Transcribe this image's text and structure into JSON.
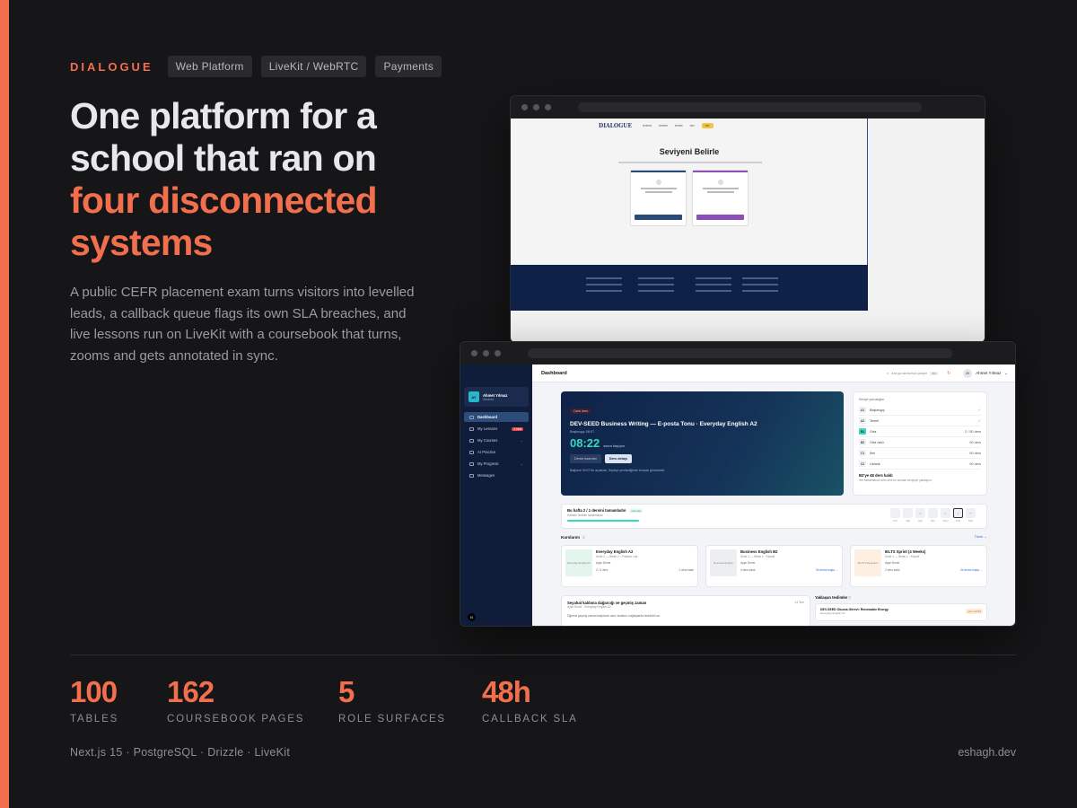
{
  "brand": "DIALOGUE",
  "tags": [
    "Web Platform",
    "LiveKit / WebRTC",
    "Payments"
  ],
  "headline": {
    "line1": "One platform for a",
    "line2": "school that ran on",
    "line3": "four disconnected",
    "line4": "systems"
  },
  "lede": "A public CEFR placement exam turns visitors into levelled leads, a callback queue flags its own SLA breaches, and live lessons run on LiveKit with a coursebook that turns, zooms and gets annotated in sync.",
  "placement": {
    "logo": "DIALOGUE",
    "title": "Seviyeni Belirle"
  },
  "dashboard": {
    "title": "Dashboard",
    "search_placeholder": "Ara ya da komut çalıştır",
    "kbd": "⌘K",
    "user_name": "Ahmet Yılmaz",
    "user_initials": "AY",
    "user_role": "Student",
    "nav": [
      {
        "label": "Dashboard",
        "badge": ""
      },
      {
        "label": "My Lessons",
        "badge": "1 new"
      },
      {
        "label": "My Courses",
        "badge": ""
      },
      {
        "label": "AI Practice",
        "badge": ""
      },
      {
        "label": "My Progress",
        "badge": ""
      },
      {
        "label": "Messages",
        "badge": ""
      }
    ],
    "hero": {
      "pill": "Canlı ders",
      "title": "DEV-SEED Business Writing — E-posta Tonu · Everyday English A2",
      "start": "Başlangıç 08:07",
      "countdown": "08:22",
      "countdown_suffix": "sonra başlıyor",
      "btn_join": "Derse hazırlan",
      "btn_detail": "Ders detayı",
      "note": "Bağlantı 00:07'de açılacak. Sayfayı yenilediğinde burada görünecek."
    },
    "levels": {
      "heading": "Seviye yolculuğun",
      "rows": [
        {
          "code": "A1",
          "name": "Başlangıç",
          "right": "✓"
        },
        {
          "code": "A2",
          "name": "Temel",
          "right": "✓"
        },
        {
          "code": "B1",
          "name": "Orta",
          "right": "2 / 50 ders"
        },
        {
          "code": "B2",
          "name": "Orta üstü",
          "right": "50 ders"
        },
        {
          "code": "C1",
          "name": "İleri",
          "right": "50 ders"
        },
        {
          "code": "C2",
          "name": "Ustalık",
          "right": "50 ders"
        }
      ],
      "foot": "B2'ye 48 ders kaldı",
      "foot_sub": "Her tamamlanan ders seni bir sonraki seviyeye yaklaştırır."
    },
    "week": {
      "title": "Bu hafta 2 / 1 dersini tamamladın",
      "pill": "yolunda",
      "sub": "Haftalık hedefin tamamlandı",
      "progress": 1,
      "days": [
        {
          "label": "Pzt",
          "mark": ""
        },
        {
          "label": "Sal",
          "mark": ""
        },
        {
          "label": "Çar",
          "mark": "✓"
        },
        {
          "label": "Per",
          "mark": ""
        },
        {
          "label": "Cum",
          "mark": "✓"
        },
        {
          "label": "Cmt",
          "mark": "•"
        },
        {
          "label": "Paz",
          "mark": "+"
        }
      ]
    },
    "courses_heading": "Kurslarım",
    "courses_count": "3",
    "courses_all": "Tümü →",
    "courses": [
      {
        "thumb": "Everyday English A2",
        "title": "Everyday English A2",
        "sub": "Ünite 2 — Week 2 · Practice Lab",
        "teacher": "Ayşe Demir",
        "progress": "2 / 4 ders",
        "right": "2 ders kaldı",
        "thumb_color": "#e4f5ee"
      },
      {
        "thumb": "Business English",
        "title": "Business English B2",
        "sub": "Ünite 1 — Week 1 · Kickoff",
        "teacher": "Ayşe Demir",
        "progress": "4 ders kaldı",
        "right": "İlk derse başla →",
        "thumb_color": "#eceef2"
      },
      {
        "thumb": "IELTS Preparation",
        "title": "IELTS Sprint (4 Weeks)",
        "sub": "Ünite 1 — Week 1 · Kickoff",
        "teacher": "Ayşe Demir",
        "progress": "2 ders kaldı",
        "right": "İlk derse başla →",
        "thumb_color": "#fdf0e2"
      }
    ],
    "topic": {
      "title": "Seyahat kalıbına dağarcığı ve geçmiş zaman",
      "sub": "Ayşe Demir · Everyday English A2",
      "date": "14 Tem",
      "body": "Öğrenci geçmiş zaman kalıplarını akıcı kullandı, bağlaçlarda tereddüt var."
    },
    "upcoming_heading": "Yaklaşan teslimler",
    "upcoming_count": "2",
    "upcoming": {
      "title": "DEV-SEED Okuma Görevi: Renewable Energy",
      "sub": "Everyday English A2",
      "badge": "yarın 23:59"
    }
  },
  "stats": [
    {
      "num": "100",
      "label": "TABLES"
    },
    {
      "num": "162",
      "label": "COURSEBOOK PAGES"
    },
    {
      "num": "5",
      "label": "ROLE SURFACES"
    },
    {
      "num": "48h",
      "label": "CALLBACK SLA"
    }
  ],
  "stack": "Next.js 15 · PostgreSQL · Drizzle · LiveKit",
  "site": "eshagh.dev",
  "colors": {
    "accent": "#f26f4e",
    "background": "#161618",
    "teal": "#39d9c0"
  }
}
